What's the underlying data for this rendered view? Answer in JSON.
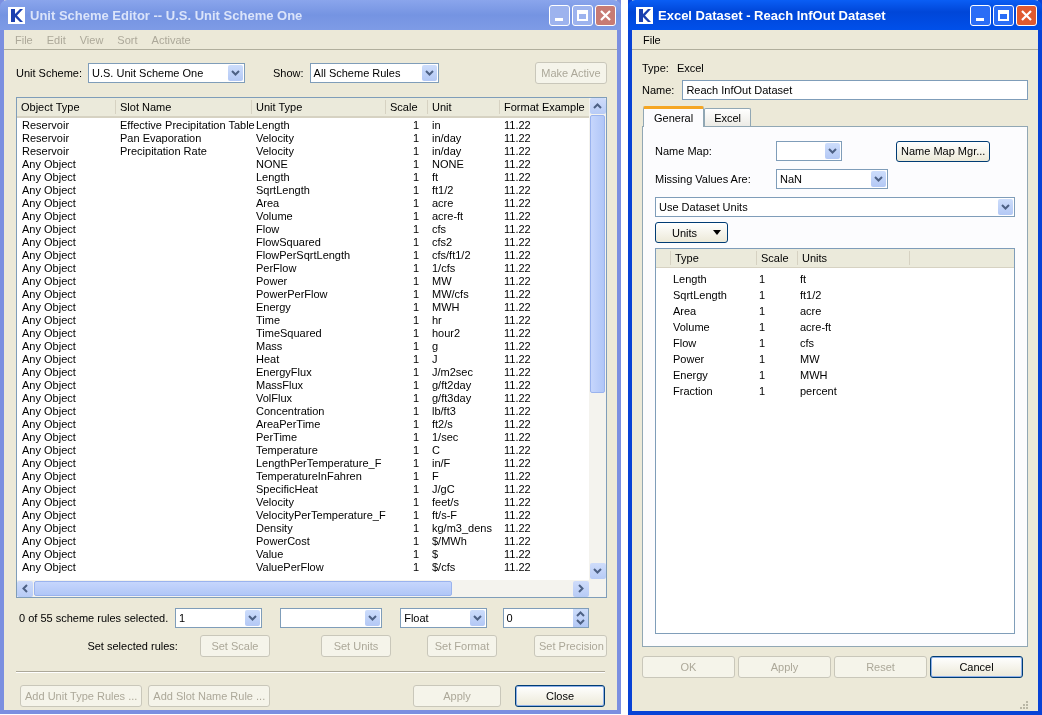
{
  "unit_scheme_editor": {
    "title": "Unit Scheme Editor -- U.S. Unit Scheme One",
    "active": false,
    "menu": [
      {
        "label": "File",
        "disabled": true
      },
      {
        "label": "Edit",
        "disabled": true
      },
      {
        "label": "View",
        "disabled": true
      },
      {
        "label": "Sort",
        "disabled": true
      },
      {
        "label": "Activate",
        "disabled": true
      }
    ],
    "unit_scheme": {
      "label": "Unit Scheme:",
      "value": "U.S. Unit Scheme One"
    },
    "show": {
      "label": "Show:",
      "value": "All Scheme Rules"
    },
    "make_active_button": {
      "label": "Make Active",
      "disabled": true
    },
    "table": {
      "columns": [
        "Object Type",
        "Slot Name",
        "Unit Type",
        "Scale",
        "Unit",
        "Format Example"
      ],
      "rows": [
        [
          "Reservoir",
          "Effective Precipitation Table",
          "Length",
          "1",
          "in",
          "11.22"
        ],
        [
          "Reservoir",
          "Pan Evaporation",
          "Velocity",
          "1",
          "in/day",
          "11.22"
        ],
        [
          "Reservoir",
          "Precipitation Rate",
          "Velocity",
          "1",
          "in/day",
          "11.22"
        ],
        [
          "Any Object",
          "",
          "NONE",
          "1",
          "NONE",
          "11.22"
        ],
        [
          "Any Object",
          "",
          "Length",
          "1",
          "ft",
          "11.22"
        ],
        [
          "Any Object",
          "",
          "SqrtLength",
          "1",
          "ft1/2",
          "11.22"
        ],
        [
          "Any Object",
          "",
          "Area",
          "1",
          "acre",
          "11.22"
        ],
        [
          "Any Object",
          "",
          "Volume",
          "1",
          "acre-ft",
          "11.22"
        ],
        [
          "Any Object",
          "",
          "Flow",
          "1",
          "cfs",
          "11.22"
        ],
        [
          "Any Object",
          "",
          "FlowSquared",
          "1",
          "cfs2",
          "11.22"
        ],
        [
          "Any Object",
          "",
          "FlowPerSqrtLength",
          "1",
          "cfs/ft1/2",
          "11.22"
        ],
        [
          "Any Object",
          "",
          "PerFlow",
          "1",
          "1/cfs",
          "11.22"
        ],
        [
          "Any Object",
          "",
          "Power",
          "1",
          "MW",
          "11.22"
        ],
        [
          "Any Object",
          "",
          "PowerPerFlow",
          "1",
          "MW/cfs",
          "11.22"
        ],
        [
          "Any Object",
          "",
          "Energy",
          "1",
          "MWH",
          "11.22"
        ],
        [
          "Any Object",
          "",
          "Time",
          "1",
          "hr",
          "11.22"
        ],
        [
          "Any Object",
          "",
          "TimeSquared",
          "1",
          "hour2",
          "11.22"
        ],
        [
          "Any Object",
          "",
          "Mass",
          "1",
          "g",
          "11.22"
        ],
        [
          "Any Object",
          "",
          "Heat",
          "1",
          "J",
          "11.22"
        ],
        [
          "Any Object",
          "",
          "EnergyFlux",
          "1",
          "J/m2sec",
          "11.22"
        ],
        [
          "Any Object",
          "",
          "MassFlux",
          "1",
          "g/ft2day",
          "11.22"
        ],
        [
          "Any Object",
          "",
          "VolFlux",
          "1",
          "g/ft3day",
          "11.22"
        ],
        [
          "Any Object",
          "",
          "Concentration",
          "1",
          "lb/ft3",
          "11.22"
        ],
        [
          "Any Object",
          "",
          "AreaPerTime",
          "1",
          "ft2/s",
          "11.22"
        ],
        [
          "Any Object",
          "",
          "PerTime",
          "1",
          "1/sec",
          "11.22"
        ],
        [
          "Any Object",
          "",
          "Temperature",
          "1",
          "C",
          "11.22"
        ],
        [
          "Any Object",
          "",
          "LengthPerTemperature_F",
          "1",
          "in/F",
          "11.22"
        ],
        [
          "Any Object",
          "",
          "TemperatureInFahren",
          "1",
          "F",
          "11.22"
        ],
        [
          "Any Object",
          "",
          "SpecificHeat",
          "1",
          "J/gC",
          "11.22"
        ],
        [
          "Any Object",
          "",
          "Velocity",
          "1",
          "feet/s",
          "11.22"
        ],
        [
          "Any Object",
          "",
          "VelocityPerTemperature_F",
          "1",
          "ft/s-F",
          "11.22"
        ],
        [
          "Any Object",
          "",
          "Density",
          "1",
          "kg/m3_dens",
          "11.22"
        ],
        [
          "Any Object",
          "",
          "PowerCost",
          "1",
          "$/MWh",
          "11.22"
        ],
        [
          "Any Object",
          "",
          "Value",
          "1",
          "$",
          "11.22"
        ],
        [
          "Any Object",
          "",
          "ValuePerFlow",
          "1",
          "$/cfs",
          "11.22"
        ]
      ]
    },
    "selection_status": "0 of 55 scheme rules selected.",
    "scale_combo": {
      "value": "1"
    },
    "format_combo": {
      "value": "Float"
    },
    "precision_spinner": {
      "value": "0"
    },
    "set_label": "Set selected rules:",
    "set_buttons": [
      {
        "label": "Set Scale",
        "disabled": true
      },
      {
        "label": "Set Units",
        "disabled": true
      },
      {
        "label": "Set Format",
        "disabled": true
      },
      {
        "label": "Set Precision",
        "disabled": true
      }
    ],
    "add_buttons": [
      {
        "label": "Add Unit Type Rules ...",
        "disabled": true
      },
      {
        "label": "Add Slot Name Rule ...",
        "disabled": true
      }
    ],
    "footer_buttons": [
      {
        "label": "Apply",
        "disabled": true,
        "default": false
      },
      {
        "label": "Close",
        "disabled": false,
        "default": true
      }
    ]
  },
  "excel_dataset": {
    "title": "Excel Dataset - Reach InfOut Dataset",
    "active": true,
    "menu": [
      {
        "label": "File",
        "disabled": false
      }
    ],
    "type": {
      "label": "Type:",
      "value": "Excel"
    },
    "name": {
      "label": "Name:",
      "value": "Reach InfOut Dataset"
    },
    "tabs": [
      {
        "label": "General",
        "selected": true
      },
      {
        "label": "Excel",
        "selected": false
      }
    ],
    "name_map": {
      "label": "Name Map:"
    },
    "name_map_button": {
      "label": "Name Map Mgr...",
      "disabled": false
    },
    "missing_values": {
      "label": "Missing Values Are:",
      "value": "NaN"
    },
    "units_mode_combo": {
      "value": "Use Dataset Units"
    },
    "units_menu_button": {
      "label": "Units"
    },
    "table": {
      "columns": [
        "Type",
        "Scale",
        "Units"
      ],
      "rows": [
        [
          "Length",
          "1",
          "ft"
        ],
        [
          "SqrtLength",
          "1",
          "ft1/2"
        ],
        [
          "Area",
          "1",
          "acre"
        ],
        [
          "Volume",
          "1",
          "acre-ft"
        ],
        [
          "Flow",
          "1",
          "cfs"
        ],
        [
          "Power",
          "1",
          "MW"
        ],
        [
          "Energy",
          "1",
          "MWH"
        ],
        [
          "Fraction",
          "1",
          "percent"
        ]
      ]
    },
    "footer_buttons": [
      {
        "label": "OK",
        "disabled": true,
        "default": false
      },
      {
        "label": "Apply",
        "disabled": true,
        "default": false
      },
      {
        "label": "Reset",
        "disabled": true,
        "default": false
      },
      {
        "label": "Cancel",
        "disabled": false,
        "default": true
      }
    ]
  }
}
